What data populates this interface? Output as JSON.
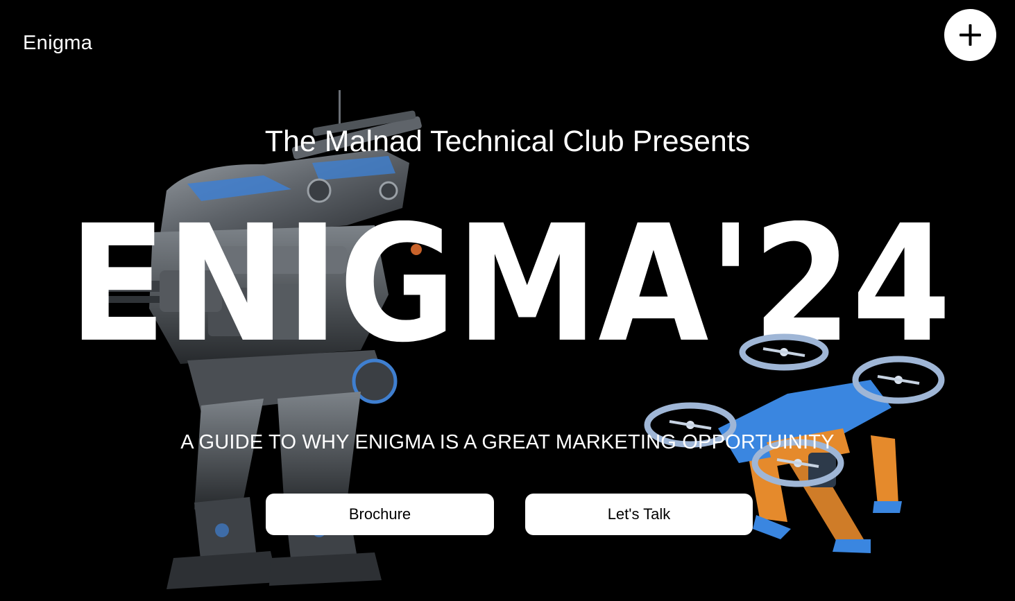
{
  "header": {
    "brand": "Enigma",
    "menu_icon": "plus-icon"
  },
  "hero": {
    "presenter": "The Malnad Technical Club Presents",
    "event_title": "ENIGMA'24",
    "tagline": "A GUIDE TO WHY ENIGMA IS A GREAT MARKETING OPPORTUINITY"
  },
  "actions": {
    "brochure_label": "Brochure",
    "talk_label": "Let's Talk"
  },
  "colors": {
    "background": "#000000",
    "text": "#ffffff",
    "button_bg": "#ffffff",
    "button_text": "#000000",
    "robot_accent": "#3f7fd0",
    "drone_body": "#3a86e0",
    "drone_legs": "#e58a2c"
  }
}
